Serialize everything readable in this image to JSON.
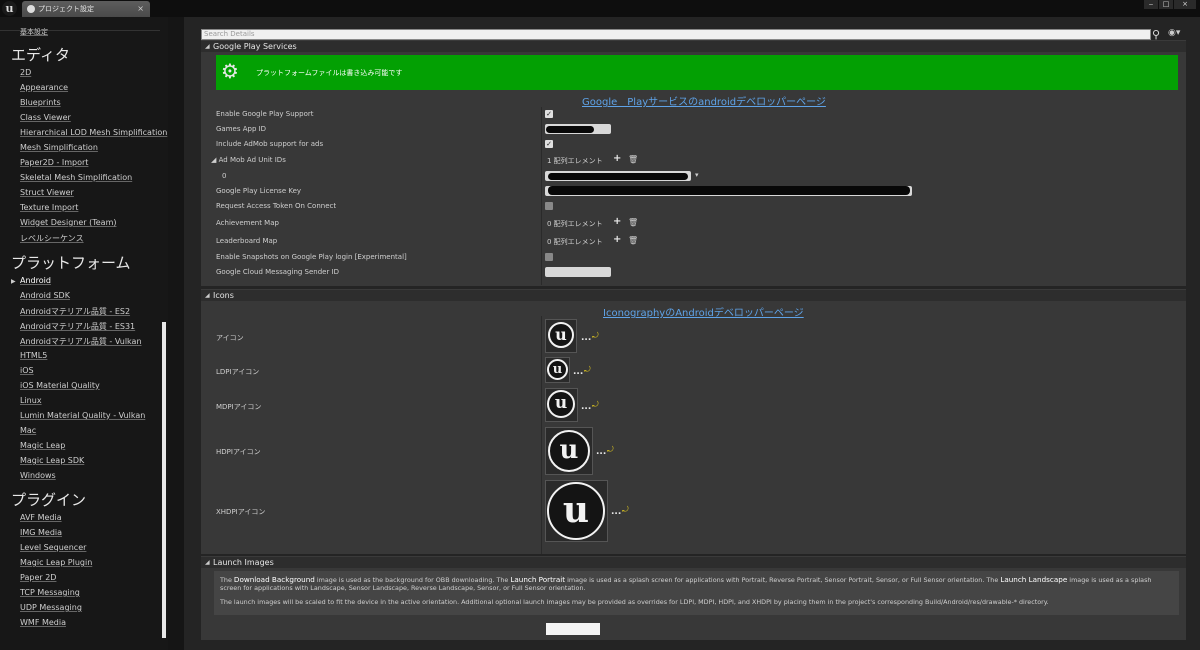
{
  "app": {
    "logo": "u",
    "tab_title": "プロジェクト設定",
    "tab_close": "×"
  },
  "window": {
    "minimize": "‒",
    "maximize": "□",
    "close": "×"
  },
  "sidebar": {
    "top_item": "基本設定",
    "editor_head": "エディタ",
    "editor_items": [
      "2D",
      "Appearance",
      "Blueprints",
      "Class Viewer",
      "Hierarchical LOD Mesh Simplification",
      "Mesh Simplification",
      "Paper2D - Import",
      "Skeletal Mesh Simplification",
      "Struct Viewer",
      "Texture Import",
      "Widget Designer (Team)",
      "レベルシーケンス"
    ],
    "platform_head": "プラットフォーム",
    "platform_items": [
      "Android",
      "Android SDK",
      "Androidマテリアル品質 - ES2",
      "Androidマテリアル品質 - ES31",
      "Androidマテリアル品質 - Vulkan",
      "HTML5",
      "iOS",
      "iOS Material Quality",
      "Linux",
      "Lumin Material Quality - Vulkan",
      "Mac",
      "Magic Leap",
      "Magic Leap SDK",
      "Windows"
    ],
    "plugin_head": "プラグイン",
    "plugin_items": [
      "AVF Media",
      "IMG Media",
      "Level Sequencer",
      "Magic Leap Plugin",
      "Paper 2D",
      "TCP Messaging",
      "UDP Messaging",
      "WMF Media"
    ]
  },
  "search": {
    "placeholder": "Search Details"
  },
  "google": {
    "header": "Google Play Services",
    "banner_text": "プラットフォームファイルは書き込み可能です",
    "dev_link": "Google　Playサービスのandroidデベロッパーページ",
    "props": {
      "enable_support": "Enable Google Play Support",
      "app_id": "Games App ID",
      "admob": "Include AdMob support for ads",
      "ad_unit_ids": "Ad Mob Ad Unit IDs",
      "index0": "0",
      "license_key": "Google Play License Key",
      "access_token": "Request Access Token On Connect",
      "achievement_map": "Achievement Map",
      "leaderboard_map": "Leaderboard Map",
      "snapshots": "Enable Snapshots on Google Play login [Experimental]",
      "gcm_sender": "Google Cloud Messaging Sender ID"
    },
    "ad_unit_count": "1 配列エレメント",
    "achievement_count": "0 配列エレメント",
    "leaderboard_count": "0 配列エレメント"
  },
  "icons": {
    "header": "Icons",
    "dev_link": "IconographyのAndroidデベロッパーページ",
    "labels": [
      "アイコン",
      "LDPIアイコン",
      "MDPIアイコン",
      "HDPIアイコン",
      "XHDPIアイコン"
    ],
    "dots": "...",
    "reset": "⤾",
    "glyph": "u"
  },
  "launch": {
    "header": "Launch Images",
    "p1_a": "The ",
    "p1_b": "Download Background",
    "p1_c": " image is used as the background for OBB downloading.  The ",
    "p1_d": "Launch Portrait",
    "p1_e": " image is used as a splash screen for applications with Portrait, Reverse Portrait, Sensor Portrait, Sensor, or Full Sensor orientation.  The ",
    "p1_f": "Launch Landscape",
    "p1_g": " image is used as a splash screen for applications with Landscape, Sensor Landscape, Reverse Landscape, Sensor, or Full Sensor orientation.",
    "p2": "The launch images will be scaled to fit the device in the active orientation. Additional optional launch images may be provided as overrides for LDPI, MDPI, HDPI, and XHDPI by placing them in the project's corresponding Build/Android/res/drawable-* directory."
  },
  "colors": {
    "banner": "#03a003",
    "link": "#5fa3e8",
    "panel": "#383838"
  }
}
